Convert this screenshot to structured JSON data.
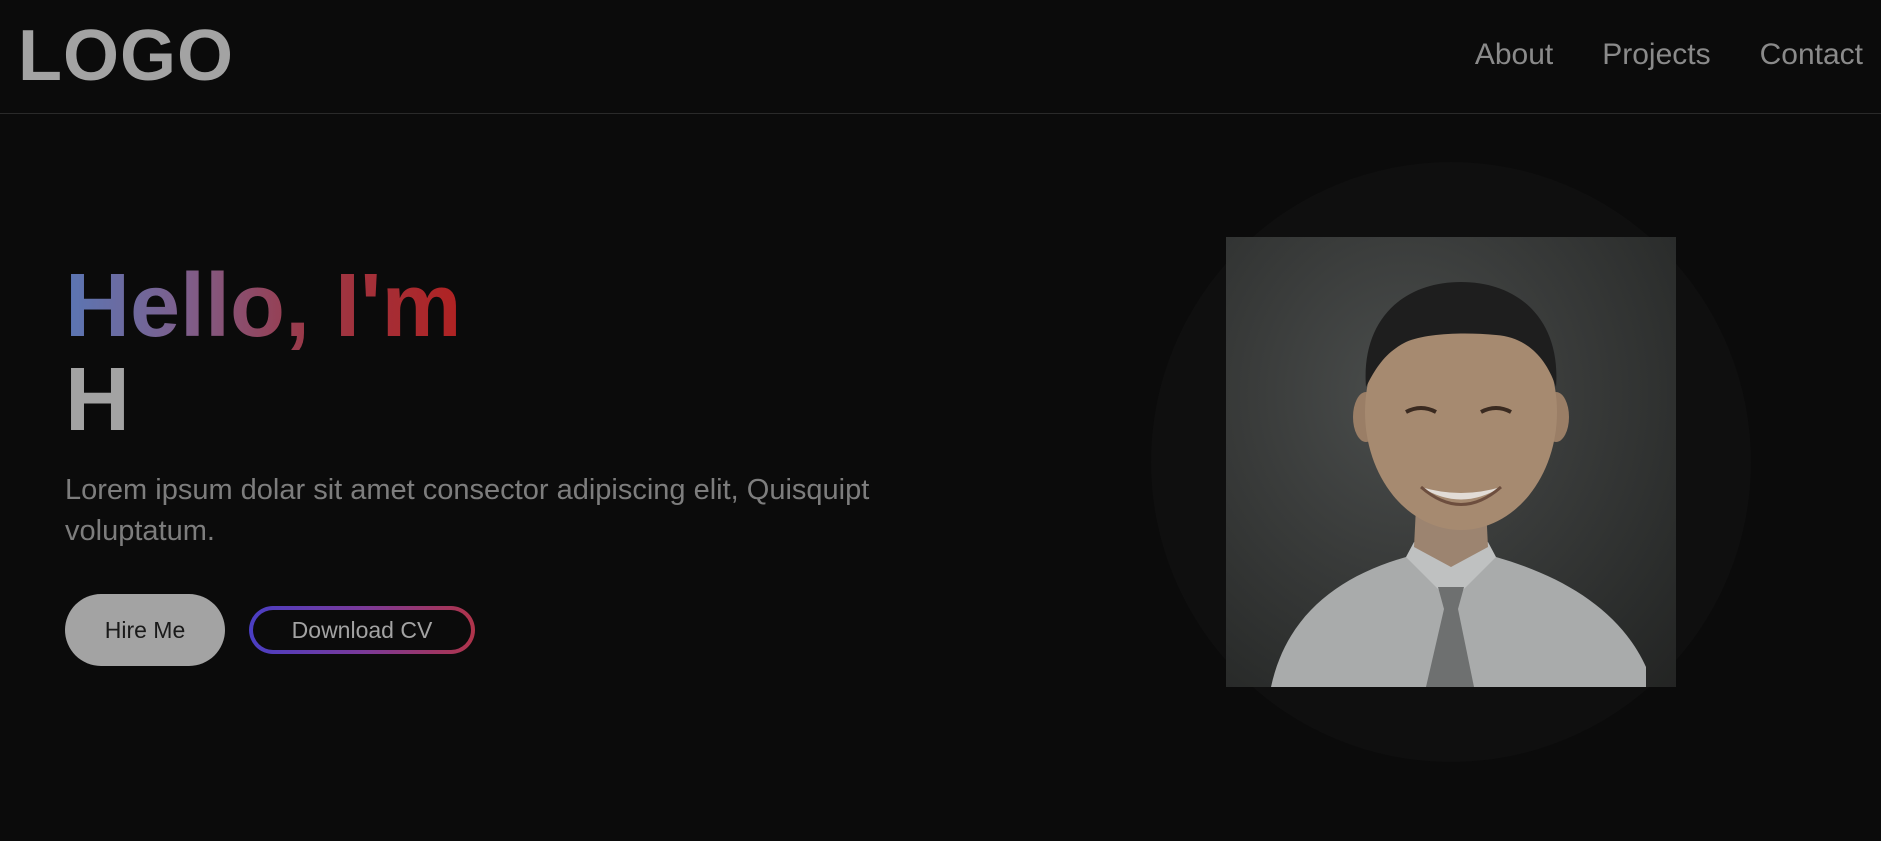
{
  "header": {
    "logo": "LOGO",
    "nav": [
      {
        "label": "About"
      },
      {
        "label": "Projects"
      },
      {
        "label": "Contact"
      }
    ]
  },
  "hero": {
    "greeting": "Hello, I'm",
    "name": "H",
    "tagline": "Lorem ipsum dolar sit amet consector adipiscing elit, Quisquipt voluptatum.",
    "hire_label": "Hire Me",
    "cv_label": "Download CV"
  },
  "colors": {
    "background": "#0b0b0b",
    "text_muted": "#7d7d7d",
    "logo": "#a3a3a3",
    "gradient_start": "#5a76b4",
    "gradient_end": "#b02222",
    "button_bg": "#a3a3a3"
  },
  "icons": [
    "profile-photo"
  ]
}
